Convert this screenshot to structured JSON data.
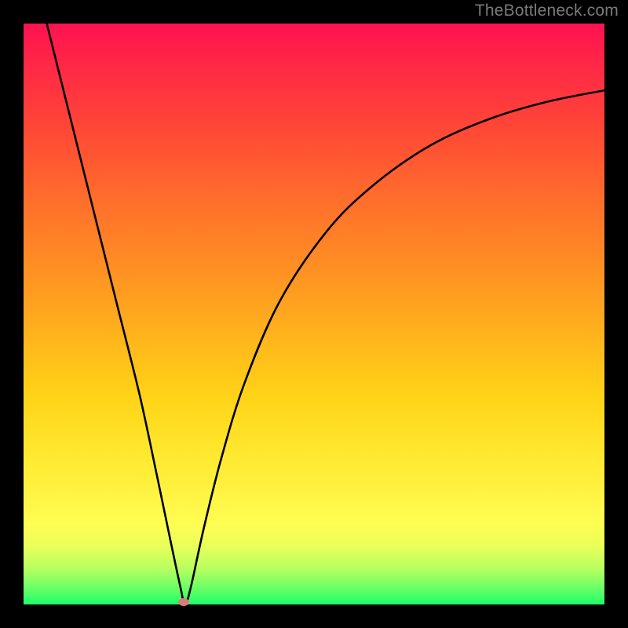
{
  "watermark": "TheBottleneck.com",
  "chart_data": {
    "type": "line",
    "title": "",
    "xlabel": "",
    "ylabel": "",
    "xlim": [
      0,
      100
    ],
    "ylim": [
      0,
      100
    ],
    "grid": false,
    "legend": false,
    "series": [
      {
        "name": "curve",
        "x": [
          4,
          8,
          12,
          16,
          20,
          23,
          25.5,
          27,
          27.8,
          28.8,
          31,
          34,
          38,
          44,
          52,
          60,
          70,
          80,
          90,
          100
        ],
        "y": [
          100,
          84,
          68,
          52,
          36,
          22,
          10,
          3,
          0,
          3,
          13,
          25,
          38,
          52,
          64,
          72,
          79,
          83.5,
          86.5,
          88.5
        ]
      }
    ],
    "marker": {
      "x": 27.6,
      "y": 0.4
    },
    "background_gradient": {
      "top": "#ff1251",
      "bottom": "#1eff6b",
      "direction": "vertical"
    },
    "curve_color": "#000000",
    "marker_color": "#d87d7a"
  }
}
